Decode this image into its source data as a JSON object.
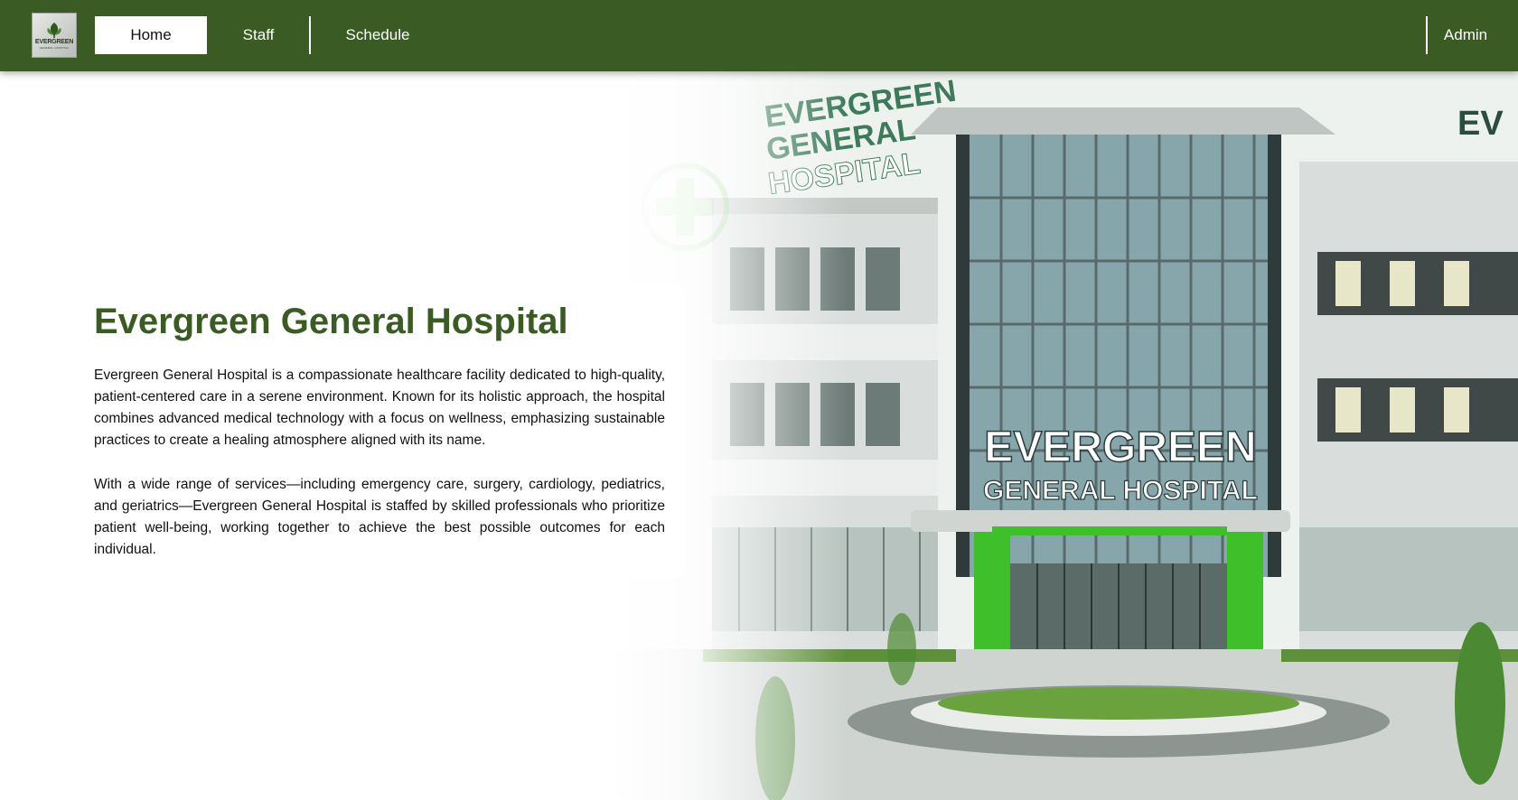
{
  "nav": {
    "logo": {
      "line1": "EVERGREEN",
      "line2": "GENERAL HOSPITAL"
    },
    "items": [
      {
        "label": "Home",
        "active": true
      },
      {
        "label": "Staff",
        "active": false
      },
      {
        "label": "Schedule",
        "active": false
      }
    ],
    "admin_label": "Admin"
  },
  "hero": {
    "title": "Evergreen General Hospital",
    "paragraphs": [
      "Evergreen General Hospital is a compassionate healthcare facility dedicated to high-quality, patient-centered care in a serene environment. Known for its holistic approach, the hospital combines advanced medical technology with a focus on wellness, emphasizing sustainable practices to create a healing atmosphere aligned with its name.",
      "With a wide range of services—including emergency care, surgery, cardiology, pediatrics, and geriatrics—Evergreen General Hospital is staffed by skilled professionals who prioritize patient well-being, working together to achieve the best possible outcomes for each individual."
    ],
    "image": {
      "sign_main_line1": "EVERGREEN",
      "sign_main_line2": "GENERAL HOSPITAL",
      "sign_left_line1": "EVERGREEN",
      "sign_left_line2": "GENERAL",
      "sign_left_line3": "HOSPITAL"
    }
  },
  "colors": {
    "primary_green": "#3a5c24",
    "accent_green": "#3fbf2a",
    "nav_text": "#ffffff"
  }
}
